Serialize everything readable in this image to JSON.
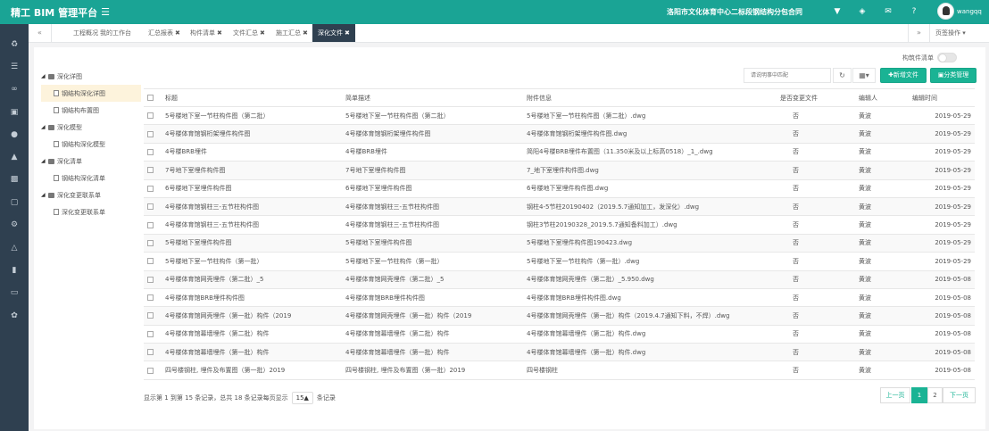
{
  "header": {
    "title": "精工 BIM 管理平台",
    "project": "洛阳市文化体育中心二标段钢结构分包合同",
    "username": "wangqq",
    "icons": [
      "filter-icon",
      "bell-icon",
      "mail-icon",
      "help-icon"
    ]
  },
  "sidebar_icons": [
    "recycle-icon",
    "layers-icon",
    "network-icon",
    "briefcase-icon",
    "users-icon",
    "bank-icon",
    "book-icon",
    "money-icon",
    "gears-icon",
    "bell-icon",
    "signal-icon",
    "monitor-icon",
    "leaf-icon"
  ],
  "tabs": [
    {
      "label": "工程概况",
      "closable": false
    },
    {
      "label": "我的工作台",
      "closable": false
    },
    {
      "label": "汇总报表",
      "closable": true
    },
    {
      "label": "构件清单",
      "closable": true
    },
    {
      "label": "文件汇总",
      "closable": true
    },
    {
      "label": "施工汇总",
      "closable": true
    },
    {
      "label": "深化文件",
      "closable": true,
      "active": true
    }
  ],
  "tab_ops": "页签操作",
  "toggle_label": "构筑件清单",
  "tree": [
    {
      "label": "深化详图",
      "level": 0
    },
    {
      "label": "钢结构深化详图",
      "level": 1,
      "selected": true
    },
    {
      "label": "钢结构布置图",
      "level": 1
    },
    {
      "label": "深化模型",
      "level": 0
    },
    {
      "label": "钢结构深化模型",
      "level": 1
    },
    {
      "label": "深化清单",
      "level": 0
    },
    {
      "label": "钢结构深化清单",
      "level": 1
    },
    {
      "label": "深化变更联系单",
      "level": 0
    },
    {
      "label": "深化变更联系单",
      "level": 1
    }
  ],
  "toolbar": {
    "search_placeholder": "请说明事中匹配",
    "refresh_icon": "refresh-icon",
    "columns_icon": "columns-icon",
    "new_file": "✚新增文件",
    "classify": "分类管理"
  },
  "table": {
    "headers": [
      "标题",
      "简单描述",
      "附件信息",
      "是否变更文件",
      "编辑人",
      "编辑时间"
    ],
    "rows": [
      [
        "5号楼地下室一节柱构件图（第二批）",
        "5号楼地下室一节柱构件图（第二批）",
        "5号楼地下室一节柱构件图（第二批）.dwg",
        "否",
        "黄波",
        "2019-05-29"
      ],
      [
        "4号楼体育馆钢桁架埋件构件图",
        "4号楼体育馆钢桁架埋件构件图",
        "4号楼体育馆钢桁架埋件构件图.dwg",
        "否",
        "黄波",
        "2019-05-29"
      ],
      [
        "4号楼BRB埋件",
        "4号楼BRB埋件",
        "简阳4号楼BRB埋件布置图（11.350米及以上标高0518）_1_.dwg",
        "否",
        "黄波",
        "2019-05-29"
      ],
      [
        "7号地下室埋件构件图",
        "7号地下室埋件构件图",
        "7_地下室埋件构件图.dwg",
        "否",
        "黄波",
        "2019-05-29"
      ],
      [
        "6号楼地下室埋件构件图",
        "6号楼地下室埋件构件图",
        "6号楼地下室埋件构件图.dwg",
        "否",
        "黄波",
        "2019-05-29"
      ],
      [
        "4号楼体育馆钢柱三-五节柱构件图",
        "4号楼体育馆钢柱三-五节柱构件图",
        "钢柱4-5节柱20190402（2019.5.7通知加工，发深化）.dwg",
        "否",
        "黄波",
        "2019-05-29"
      ],
      [
        "4号楼体育馆钢柱三-五节柱构件图",
        "4号楼体育馆钢柱三-五节柱构件图",
        "钢柱3节柱20190328_2019.5.7通知备料加工）.dwg",
        "否",
        "黄波",
        "2019-05-29"
      ],
      [
        "5号楼地下室埋件构件图",
        "5号楼地下室埋件构件图",
        "5号楼地下室埋件构件图190423.dwg",
        "否",
        "黄波",
        "2019-05-29"
      ],
      [
        "5号楼地下室一节柱构件（第一批）",
        "5号楼地下室一节柱构件（第一批）",
        "5号楼地下室一节柱构件（第一批）.dwg",
        "否",
        "黄波",
        "2019-05-29"
      ],
      [
        "4号楼体育馆网壳埋件（第二批）_5",
        "4号楼体育馆网壳埋件（第二批）_5",
        "4号楼体育馆网壳埋件（第二批）_5.950.dwg",
        "否",
        "黄波",
        "2019-05-08"
      ],
      [
        "4号楼体育馆BRB埋件构件图",
        "4号楼体育馆BRB埋件构件图",
        "4号楼体育馆BRB埋件构件图.dwg",
        "否",
        "黄波",
        "2019-05-08"
      ],
      [
        "4号楼体育馆网壳埋件（第一批）构件（2019",
        "4号楼体育馆网壳埋件（第一批）构件（2019",
        "4号楼体育馆网壳埋件（第一批）构件（2019.4.7通知下料，不焊）.dwg",
        "否",
        "黄波",
        "2019-05-08"
      ],
      [
        "4号楼体育馆幕墙埋件（第二批）构件",
        "4号楼体育馆幕墙埋件（第二批）构件",
        "4号楼体育馆幕墙埋件（第二批）构件.dwg",
        "否",
        "黄波",
        "2019-05-08"
      ],
      [
        "4号楼体育馆幕墙埋件（第一批）构件",
        "4号楼体育馆幕墙埋件（第一批）构件",
        "4号楼体育馆幕墙埋件（第一批）构件.dwg",
        "否",
        "黄波",
        "2019-05-08"
      ],
      [
        "四号楼钢柱, 埋件及布置图（第一批）2019",
        "四号楼钢柱, 埋件及布置图（第一批）2019",
        "四号楼钢柱",
        "否",
        "黄波",
        "2019-05-08"
      ]
    ]
  },
  "footer": {
    "info_prefix": "显示第 1 到第 15 条记录，总共 18 条记录每页显示",
    "page_size": "15▲",
    "info_suffix": "条记录",
    "prev": "上一页",
    "pages": [
      "1",
      "2"
    ],
    "next": "下一页"
  }
}
